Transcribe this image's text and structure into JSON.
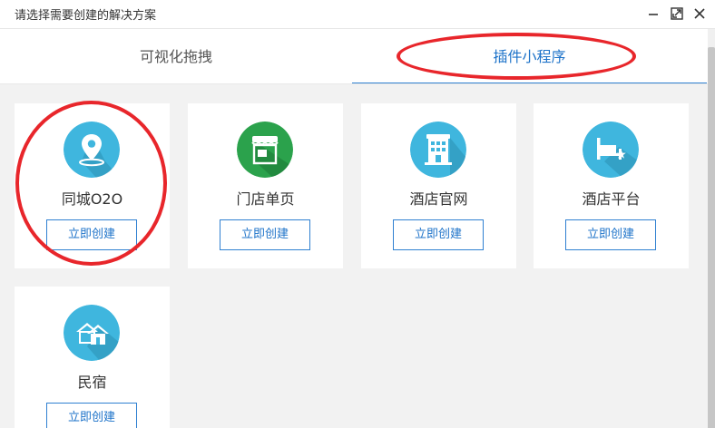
{
  "window": {
    "title": "请选择需要创建的解决方案"
  },
  "tabs": [
    {
      "label": "可视化拖拽",
      "active": false
    },
    {
      "label": "插件小程序",
      "active": true
    }
  ],
  "cards": [
    {
      "name": "同城O2O",
      "button": "立即创建",
      "icon": "location-pin-icon",
      "color": "#3fb6de"
    },
    {
      "name": "门店单页",
      "button": "立即创建",
      "icon": "storefront-icon",
      "color": "#2ba24c"
    },
    {
      "name": "酒店官网",
      "button": "立即创建",
      "icon": "hotel-building-icon",
      "color": "#3fb6de"
    },
    {
      "name": "酒店平台",
      "button": "立即创建",
      "icon": "bed-star-icon",
      "color": "#3fb6de"
    },
    {
      "name": "民宿",
      "button": "立即创建",
      "icon": "houses-icon",
      "color": "#3fb6de"
    }
  ],
  "colors": {
    "accent": "#2f80d1",
    "annotation": "#e8262b"
  }
}
